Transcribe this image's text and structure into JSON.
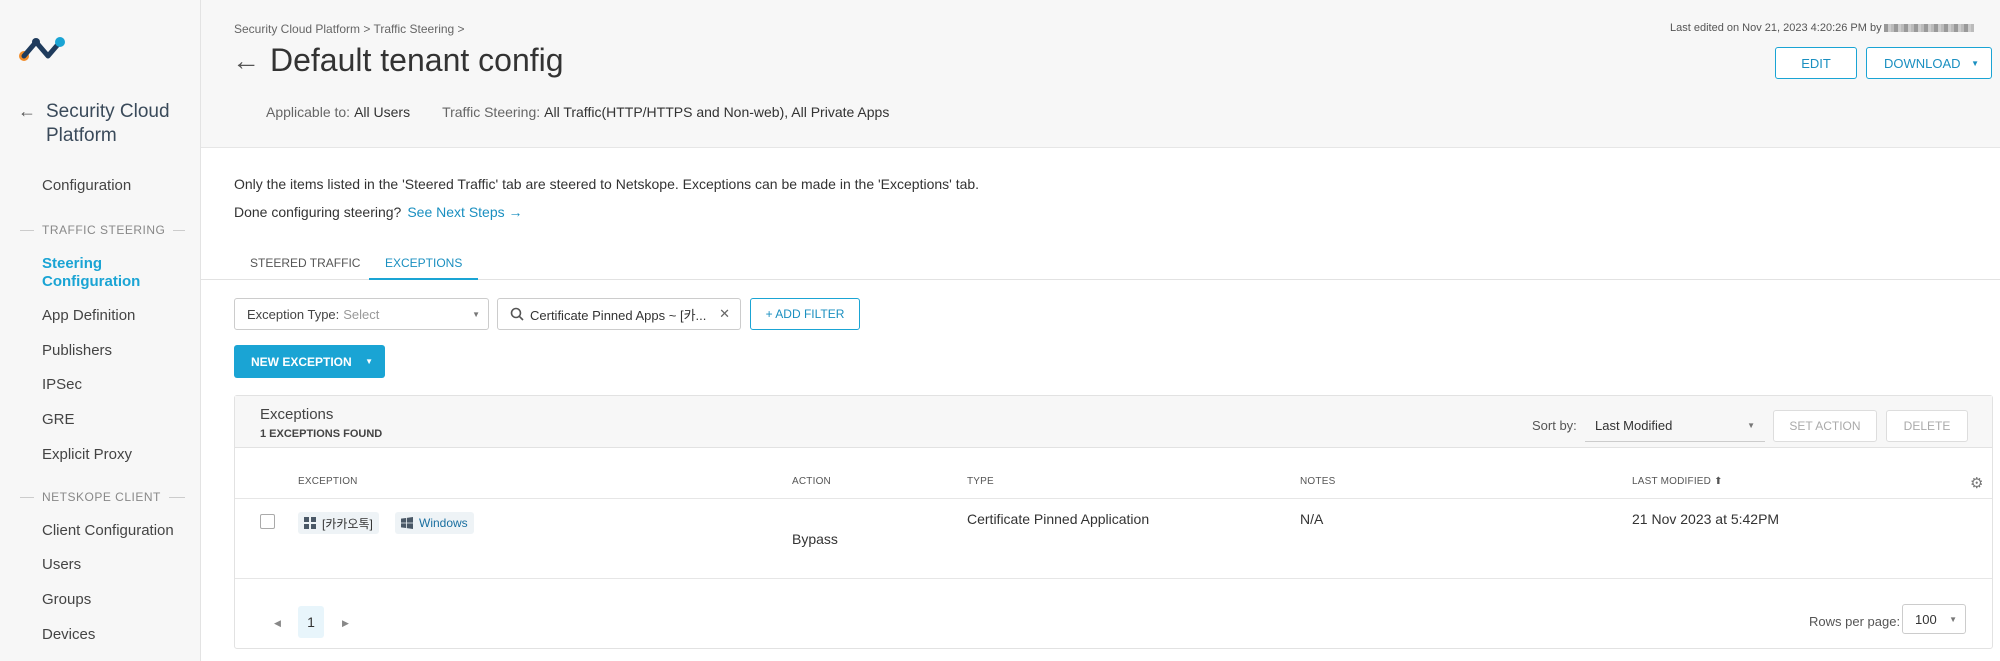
{
  "sidebar": {
    "back_label": "Security Cloud Platform",
    "items_top": [
      {
        "label": "Configuration"
      }
    ],
    "section_traffic": "TRAFFIC STEERING",
    "traffic_items": [
      {
        "label": "Steering Configuration",
        "active": true
      },
      {
        "label": "App Definition"
      },
      {
        "label": "Publishers"
      },
      {
        "label": "IPSec"
      },
      {
        "label": "GRE"
      },
      {
        "label": "Explicit Proxy"
      }
    ],
    "section_client": "NETSKOPE CLIENT",
    "client_items": [
      {
        "label": "Client Configuration"
      },
      {
        "label": "Users"
      },
      {
        "label": "Groups"
      },
      {
        "label": "Devices"
      }
    ]
  },
  "header": {
    "breadcrumb": "Security Cloud Platform > Traffic Steering >",
    "title": "Default tenant config",
    "applicable_key": "Applicable to:",
    "applicable_val": "All Users",
    "steering_key": "Traffic Steering:",
    "steering_val": "All Traffic(HTTP/HTTPS and Non-web), All Private Apps",
    "last_edited": "Last edited on Nov 21, 2023 4:20:26 PM by",
    "edit_label": "EDIT",
    "download_label": "DOWNLOAD"
  },
  "main": {
    "info_line": "Only the items listed in the 'Steered Traffic' tab are steered to Netskope. Exceptions can be made in the 'Exceptions' tab.",
    "done_text": "Done configuring steering?",
    "next_steps": "See Next Steps →",
    "tabs": [
      {
        "label": "STEERED TRAFFIC"
      },
      {
        "label": "EXCEPTIONS"
      }
    ],
    "filter_type_key": "Exception Type:",
    "filter_type_placeholder": "Select",
    "filter_chip": "Certificate Pinned Apps ~ [카...",
    "add_filter": "+ ADD FILTER",
    "new_exception": "NEW EXCEPTION"
  },
  "card": {
    "title": "Exceptions",
    "count": "1 EXCEPTIONS FOUND",
    "sort_label": "Sort by:",
    "sort_value": "Last Modified",
    "set_action": "SET ACTION",
    "delete": "DELETE",
    "columns": {
      "exception": "EXCEPTION",
      "action": "ACTION",
      "type": "TYPE",
      "notes": "NOTES",
      "last_modified": "LAST MODIFIED ⬆"
    },
    "rows": [
      {
        "app": "[카카오톡]",
        "os": "Windows",
        "action": "Bypass",
        "type": "Certificate Pinned Application",
        "notes": "N/A",
        "last_modified": "21 Nov 2023 at 5:42PM"
      }
    ],
    "page": "1",
    "rows_per_page_label": "Rows per page:",
    "rows_per_page": "100"
  },
  "colors": {
    "accent": "#1aa4d4",
    "link": "#1a8fc0",
    "logo_orange": "#f28c28",
    "logo_navy": "#1f3b5c"
  }
}
